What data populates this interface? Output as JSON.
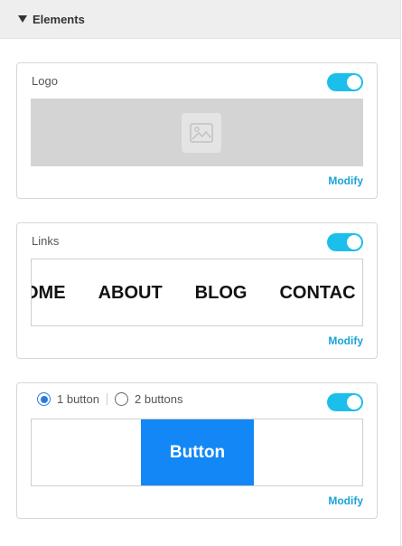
{
  "header": {
    "title": "Elements"
  },
  "logo_card": {
    "title": "Logo",
    "modify_label": "Modify",
    "enabled": true
  },
  "links_card": {
    "title": "Links",
    "nav_items": [
      "OME",
      "ABOUT",
      "BLOG",
      "CONTAC"
    ],
    "modify_label": "Modify",
    "enabled": true
  },
  "button_card": {
    "option_one_label": "1 button",
    "option_two_label": "2 buttons",
    "selected_option": "1 button",
    "button_label": "Button",
    "modify_label": "Modify",
    "enabled": true
  },
  "colors": {
    "toggle_on": "#1bbfea",
    "link": "#1aa3d6",
    "button": "#1387f5"
  }
}
